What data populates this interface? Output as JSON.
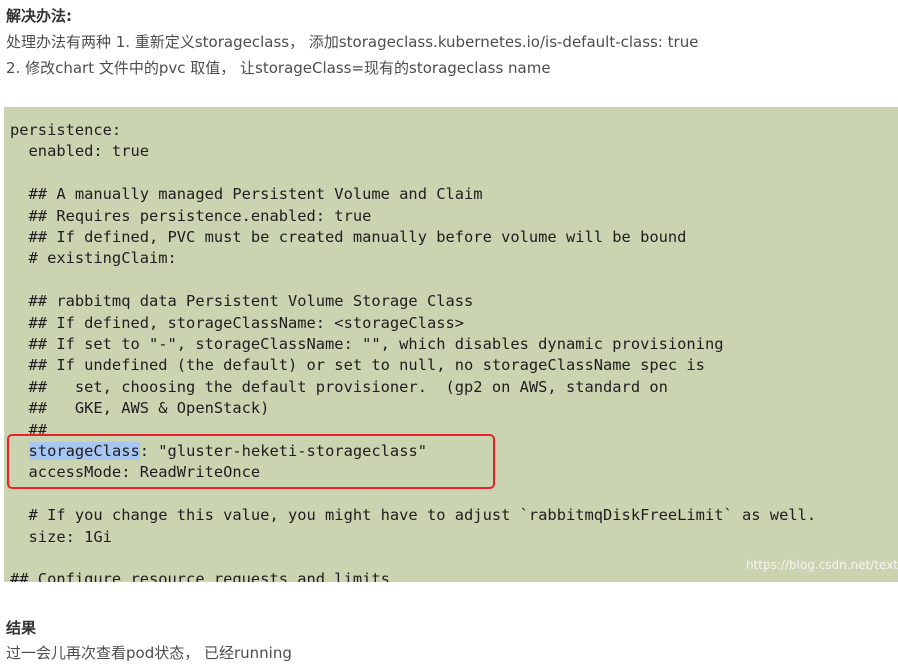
{
  "solution": {
    "heading": "解决办法:",
    "line1": "处理办法有两种 1. 重新定义storageclass， 添加storageclass.kubernetes.io/is-default-class: true",
    "line2": "2. 修改chart 文件中的pvc 取值， 让storageClass=现有的storageclass name"
  },
  "code": {
    "lines": [
      "persistence:",
      "  enabled: true",
      "",
      "  ## A manually managed Persistent Volume and Claim",
      "  ## Requires persistence.enabled: true",
      "  ## If defined, PVC must be created manually before volume will be bound",
      "  # existingClaim:",
      "",
      "  ## rabbitmq data Persistent Volume Storage Class",
      "  ## If defined, storageClassName: <storageClass>",
      "  ## If set to \"-\", storageClassName: \"\", which disables dynamic provisioning",
      "  ## If undefined (the default) or set to null, no storageClassName spec is",
      "  ##   set, choosing the default provisioner.  (gp2 on AWS, standard on",
      "  ##   GKE, AWS & OpenStack)",
      "  ##"
    ],
    "highlight_indent": "  ",
    "highlight_key": "storageClass",
    "highlight_rest": ": \"gluster-heketi-storageclass\"",
    "access_line": "  accessMode: ReadWriteOnce",
    "tail_lines": [
      "",
      "  # If you change this value, you might have to adjust `rabbitmqDiskFreeLimit` as well.",
      "  size: 1Gi",
      "",
      "## Configure resource requests and limits"
    ],
    "watermark": "https://blog.csdn.net/text"
  },
  "result": {
    "heading": "结果",
    "line1": "过一会儿再次查看pod状态， 已经running"
  },
  "colors": {
    "code_background": "#cbd4b1",
    "selection": "#a7c6f2",
    "red_box": "#e8202a"
  }
}
